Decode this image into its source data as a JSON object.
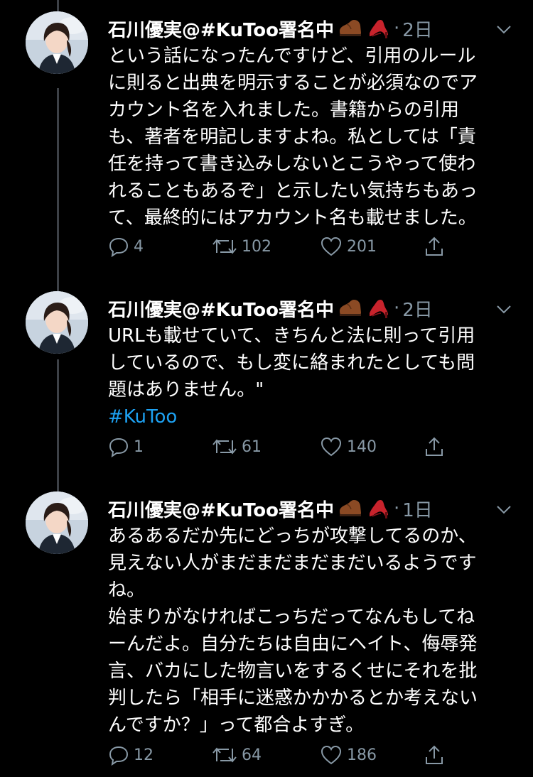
{
  "tweets": [
    {
      "author": "石川優実@#KuToo署名中",
      "dot": "·",
      "time": "2日",
      "lines": [
        "という話になったんですけど、引用のルール",
        "に則ると出典を明示することが必須なのでア",
        "カウント名を入れました。書籍からの引用",
        "も、著者を明記しますよね。私としては「責",
        "任を持って書き込みしないとこうやって使わ",
        "れることもあるぞ」と示したい気持ちもあっ",
        "て、最終的にはアカウント名も載せました。"
      ],
      "replies": "4",
      "retweets": "102",
      "likes": "201"
    },
    {
      "author": "石川優実@#KuToo署名中",
      "dot": "·",
      "time": "2日",
      "lines": [
        "URLも載せていて、きちんと法に則って引用",
        "しているので、もし変に絡まれたとしても問",
        "題はありません。\""
      ],
      "hashtag": "#KuToo",
      "replies": "1",
      "retweets": "61",
      "likes": "140"
    },
    {
      "author": "石川優実@#KuToo署名中",
      "dot": "·",
      "time": "1日",
      "lines": [
        "あるあるだか先にどっちが攻撃してるのか、",
        "見えない人がまだまだまだまだいるようです",
        "ね。",
        "始まりがなければこっちだってなんもしてね",
        "ーんだよ。自分たちは自由にヘイト、侮辱発",
        "言、バカにした物言いをするくせにそれを批",
        "判したら「相手に迷惑かかかるとか考えない",
        "んですか？」って都合よすぎ。"
      ],
      "replies": "12",
      "retweets": "64",
      "likes": "186"
    }
  ],
  "icons": {
    "emoji": [
      "mans-shoe-icon",
      "high-heel-icon"
    ],
    "caret": "chevron-down-icon",
    "reply": "reply-icon",
    "retweet": "retweet-icon",
    "like": "heart-icon",
    "share": "share-icon"
  },
  "colors": {
    "background": "#000000",
    "text": "#ffffff",
    "secondary": "#8899a6",
    "link": "#1da1f2",
    "thread_line": "#3d4147"
  }
}
